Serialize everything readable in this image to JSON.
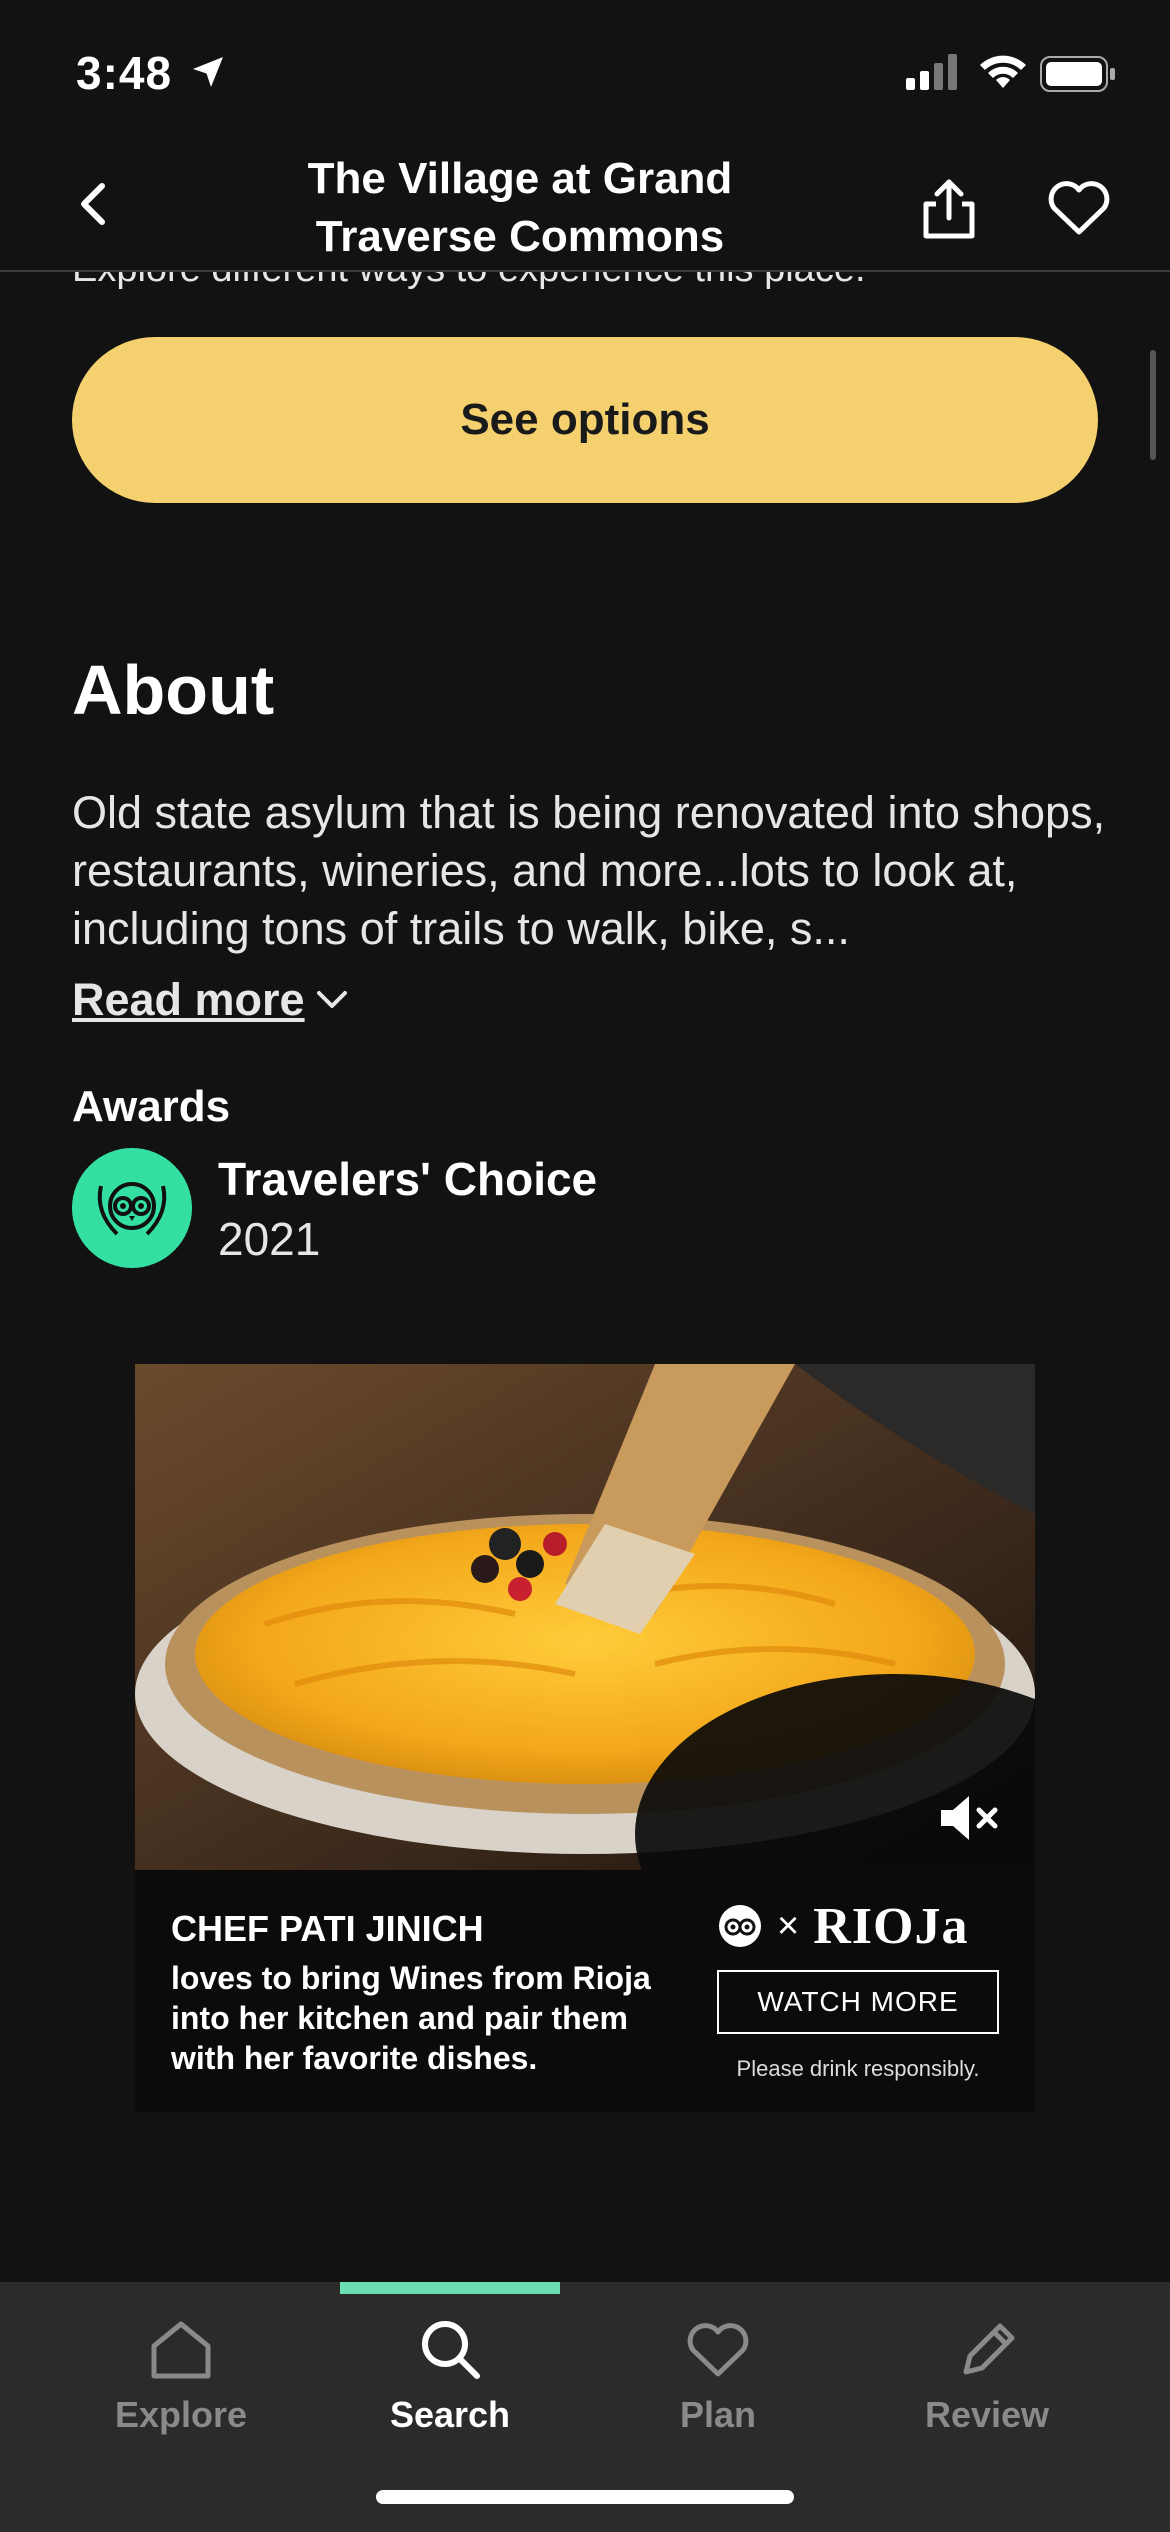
{
  "status_bar": {
    "time": "3:48"
  },
  "header": {
    "title": "The Village at Grand Traverse Commons"
  },
  "clipped_text": "Explore different ways to experience this place.",
  "cta": {
    "label": "See options"
  },
  "about": {
    "heading": "About",
    "text": "Old state asylum that is being renovated into shops, restaurants, wineries, and more...lots to look at, including tons of trails to walk, bike, s...",
    "read_more": "Read more"
  },
  "awards": {
    "label": "Awards",
    "name": "Travelers' Choice",
    "year": "2021"
  },
  "ad": {
    "headline": "CHEF PATI JINICH",
    "body": "loves to bring Wines from Rioja into her kitchen and pair them with her favorite dishes.",
    "brand_times": "×",
    "brand": "RIOJa",
    "cta": "WATCH MORE",
    "disclaimer": "Please drink responsibly."
  },
  "tabs": [
    {
      "label": "Explore",
      "icon": "home-icon"
    },
    {
      "label": "Search",
      "icon": "search-icon",
      "active": true
    },
    {
      "label": "Plan",
      "icon": "heart-icon"
    },
    {
      "label": "Review",
      "icon": "pencil-icon"
    }
  ],
  "colors": {
    "accent_button": "#f5d06f",
    "tab_active_indicator": "#6ae0b2",
    "award_badge": "#34e0a1",
    "background": "#121212"
  }
}
